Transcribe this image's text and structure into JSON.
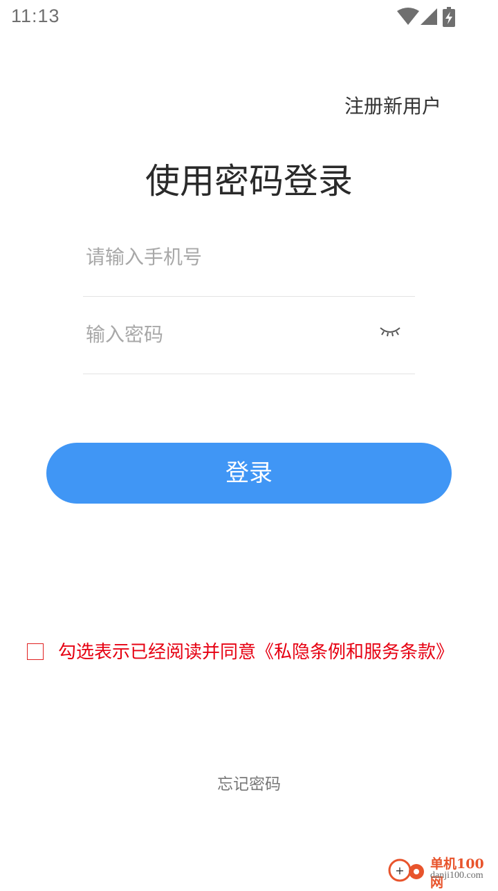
{
  "status_bar": {
    "time": "11:13",
    "icons": [
      "wifi-icon",
      "cell-signal-icon",
      "battery-charging-icon"
    ]
  },
  "header": {
    "register_label": "注册新用户"
  },
  "title": "使用密码登录",
  "form": {
    "phone_placeholder": "请输入手机号",
    "phone_value": "",
    "password_placeholder": "输入密码",
    "password_value": "",
    "password_visibility_icon": "eye-closed-icon"
  },
  "login_button_label": "登录",
  "agreement": {
    "checked": false,
    "text": "勾选表示已经阅读并同意《私隐条例和服务条款》"
  },
  "forgot_password_label": "忘记密码",
  "watermark": {
    "name": "单机100网",
    "url": "danji100.com"
  },
  "colors": {
    "primary": "#4096f5",
    "agreement_text": "#e60012",
    "title_text": "#2a2a2a",
    "placeholder": "#a8a8a8"
  }
}
